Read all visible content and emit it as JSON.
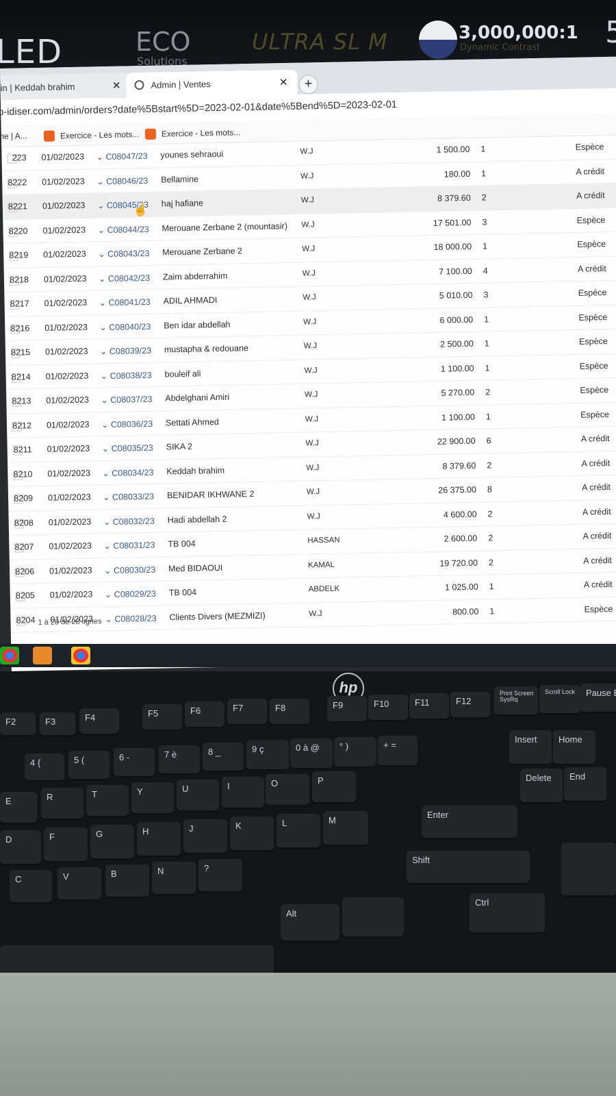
{
  "monitor": {
    "led": "LED",
    "eco": "ECO",
    "solutions": "Solutions",
    "ultraslim": "ULTRA SL M",
    "contrast": "3,000,000:1",
    "contrast_sub": "Dynamic Contrast",
    "model_digit": "5"
  },
  "browser": {
    "tabs": [
      {
        "label": "in | Keddah brahim"
      },
      {
        "label": "Admin | Ventes"
      }
    ],
    "url": "p-idiser.com/admin/orders?date%5Bstart%5D=2023-02-01&date%5Bend%5D=2023-02-01",
    "bookmarks": [
      "me | A...",
      "Exercice - Les mots...",
      "Exercice - Les mots..."
    ]
  },
  "orders": [
    {
      "id": "223",
      "date": "01/02/2023",
      "ref": "C08047/23",
      "client": "younes sehraoui",
      "agent": "W.J",
      "amount": "1 500.00",
      "qty": "1",
      "payment": "Espèce"
    },
    {
      "id": "8222",
      "date": "01/02/2023",
      "ref": "C08046/23",
      "client": "Bellamine",
      "agent": "W.J",
      "amount": "180.00",
      "qty": "1",
      "payment": "A crédit"
    },
    {
      "id": "8221",
      "date": "01/02/2023",
      "ref": "C08045/23",
      "client": "haj hafiane",
      "agent": "W.J",
      "amount": "8 379.60",
      "qty": "2",
      "payment": "A crédit"
    },
    {
      "id": "8220",
      "date": "01/02/2023",
      "ref": "C08044/23",
      "client": "Merouane Zerbane 2 (mountasir)",
      "agent": "W.J",
      "amount": "17 501.00",
      "qty": "3",
      "payment": "Espèce"
    },
    {
      "id": "8219",
      "date": "01/02/2023",
      "ref": "C08043/23",
      "client": "Merouane Zerbane 2",
      "agent": "W.J",
      "amount": "18 000.00",
      "qty": "1",
      "payment": "Espèce"
    },
    {
      "id": "8218",
      "date": "01/02/2023",
      "ref": "C08042/23",
      "client": "Zaim abderrahim",
      "agent": "W.J",
      "amount": "7 100.00",
      "qty": "4",
      "payment": "A crédit"
    },
    {
      "id": "8217",
      "date": "01/02/2023",
      "ref": "C08041/23",
      "client": "ADIL AHMADI",
      "agent": "W.J",
      "amount": "5 010.00",
      "qty": "3",
      "payment": "Espèce"
    },
    {
      "id": "8216",
      "date": "01/02/2023",
      "ref": "C08040/23",
      "client": "Ben idar abdellah",
      "agent": "W.J",
      "amount": "6 000.00",
      "qty": "1",
      "payment": "Espèce"
    },
    {
      "id": "8215",
      "date": "01/02/2023",
      "ref": "C08039/23",
      "client": "mustapha & redouane",
      "agent": "W.J",
      "amount": "2 500.00",
      "qty": "1",
      "payment": "Espèce"
    },
    {
      "id": "8214",
      "date": "01/02/2023",
      "ref": "C08038/23",
      "client": "bouleif ali",
      "agent": "W.J",
      "amount": "1 100.00",
      "qty": "1",
      "payment": "Espèce"
    },
    {
      "id": "8213",
      "date": "01/02/2023",
      "ref": "C08037/23",
      "client": "Abdelghani Amiri",
      "agent": "W.J",
      "amount": "5 270.00",
      "qty": "2",
      "payment": "Espèce"
    },
    {
      "id": "8212",
      "date": "01/02/2023",
      "ref": "C08036/23",
      "client": "Settati Ahmed",
      "agent": "W.J",
      "amount": "1 100.00",
      "qty": "1",
      "payment": "Espèce"
    },
    {
      "id": "8211",
      "date": "01/02/2023",
      "ref": "C08035/23",
      "client": "SIKA 2",
      "agent": "W.J",
      "amount": "22 900.00",
      "qty": "6",
      "payment": "A crédit"
    },
    {
      "id": "8210",
      "date": "01/02/2023",
      "ref": "C08034/23",
      "client": "Keddah brahim",
      "agent": "W.J",
      "amount": "8 379.60",
      "qty": "2",
      "payment": "A crédit"
    },
    {
      "id": "8209",
      "date": "01/02/2023",
      "ref": "C08033/23",
      "client": "BENIDAR IKHWANE 2",
      "agent": "W.J",
      "amount": "26 375.00",
      "qty": "8",
      "payment": "A crédit"
    },
    {
      "id": "8208",
      "date": "01/02/2023",
      "ref": "C08032/23",
      "client": "Hadi abdellah 2",
      "agent": "W.J",
      "amount": "4 600.00",
      "qty": "2",
      "payment": "A crédit"
    },
    {
      "id": "8207",
      "date": "01/02/2023",
      "ref": "C08031/23",
      "client": "TB 004",
      "agent": "HASSAN",
      "amount": "2 600.00",
      "qty": "2",
      "payment": "A crédit"
    },
    {
      "id": "8206",
      "date": "01/02/2023",
      "ref": "C08030/23",
      "client": "Med BIDAOUI",
      "agent": "KAMAL",
      "amount": "19 720.00",
      "qty": "2",
      "payment": "A crédit"
    },
    {
      "id": "8205",
      "date": "01/02/2023",
      "ref": "C08029/23",
      "client": "TB 004",
      "agent": "ABDELK",
      "amount": "1 025.00",
      "qty": "1",
      "payment": "A crédit"
    },
    {
      "id": "8204",
      "date": "01/02/2023",
      "ref": "C08028/23",
      "client": "Clients Divers (MEZMIZI)",
      "agent": "W.J",
      "amount": "800.00",
      "qty": "1",
      "payment": "Espèce"
    }
  ],
  "pagination": "1 à 20 de 28 lignes",
  "keyboard": {
    "brand": "hp",
    "keys": [
      "F2",
      "F3",
      "F4",
      "F5",
      "F6",
      "F7",
      "F8",
      "F9",
      "F10",
      "F11",
      "F12",
      "Print Screen SysRq",
      "Scroll Lock",
      "Pause Bre",
      "4 {",
      "5 (",
      "6 -",
      "7 è",
      "8 _",
      "9 ç",
      "0 à @",
      "° )",
      "+ =",
      "Insert",
      "Home",
      "E",
      "R",
      "T",
      "Y",
      "U",
      "I",
      "O",
      "P",
      "Delete",
      "End",
      "D",
      "F",
      "G",
      "H",
      "J",
      "K",
      "L",
      "M",
      "Enter",
      "C",
      "V",
      "B",
      "N",
      "?",
      "Shift",
      "Alt",
      "Ctrl"
    ]
  }
}
